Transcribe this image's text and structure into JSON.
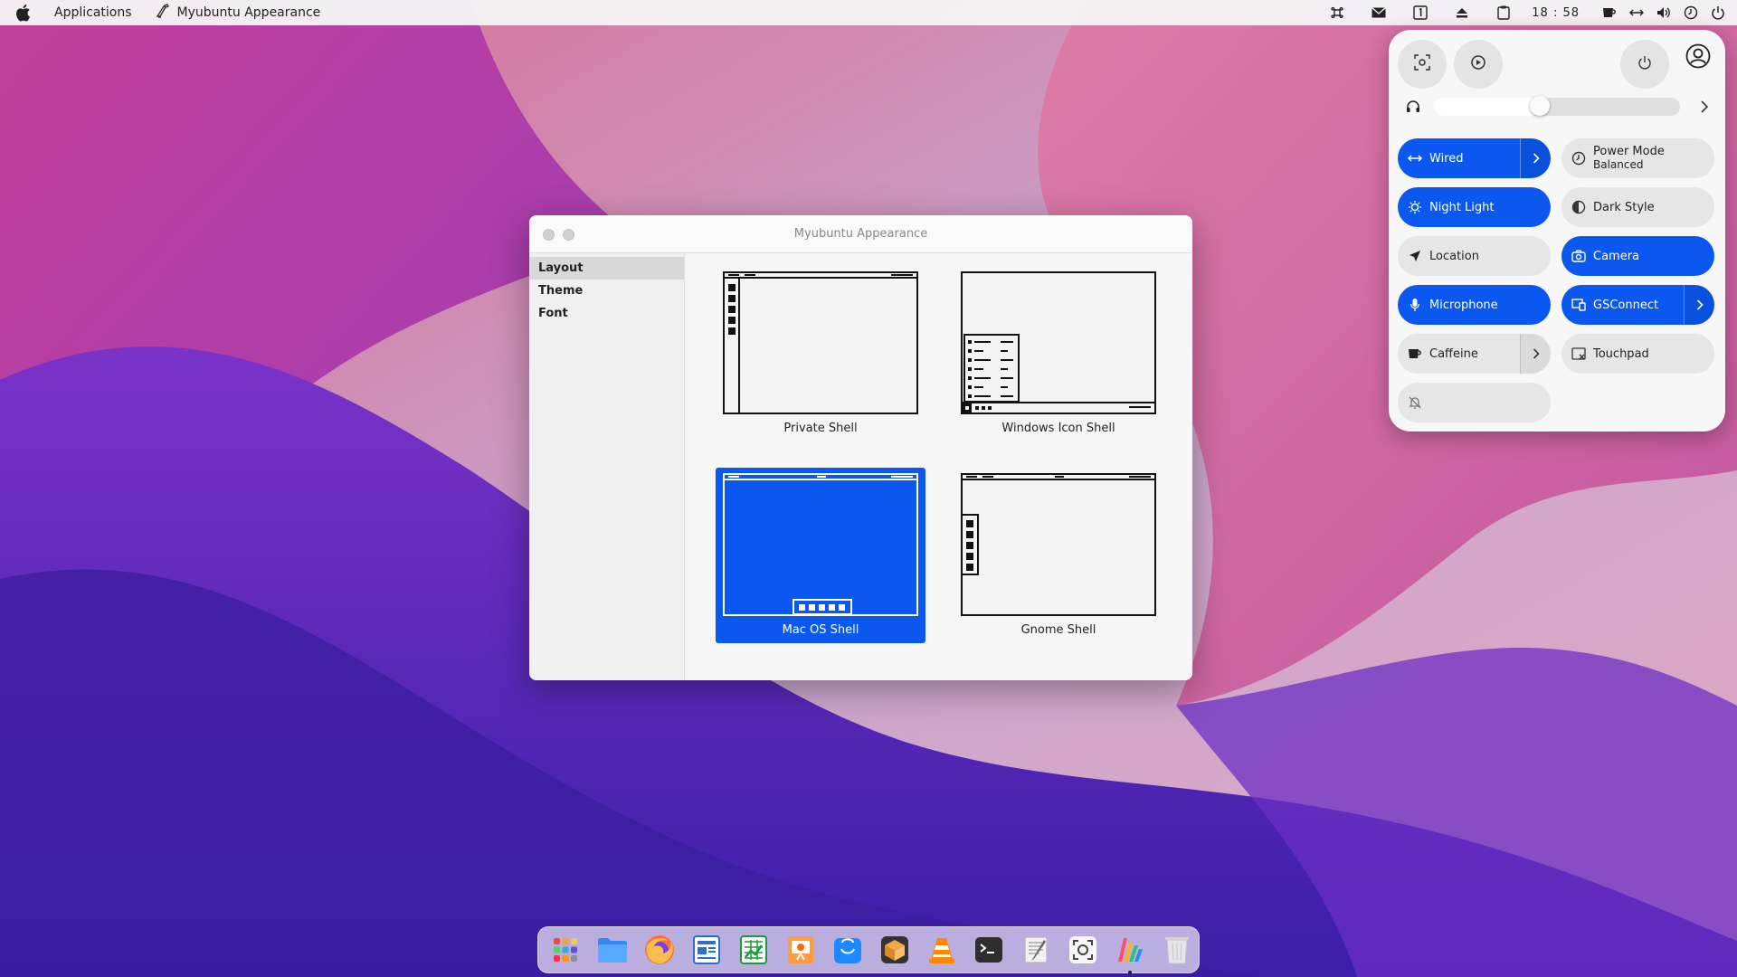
{
  "topbar": {
    "apple_icon": "apple-logo-icon",
    "menu_applications": "Applications",
    "active_app_title": "Myubuntu Appearance",
    "clock": "18 : 58",
    "tray_icons": [
      "command-icon",
      "mail-icon",
      "workspace-1-icon",
      "eject-icon",
      "clipboard-icon",
      "caffeine-icon",
      "network-wired-icon",
      "volume-icon",
      "power-mode-icon",
      "power-icon"
    ]
  },
  "window": {
    "title": "Myubuntu Appearance",
    "sidebar": {
      "items": [
        {
          "label": "Layout",
          "active": true
        },
        {
          "label": "Theme",
          "active": false
        },
        {
          "label": "Font",
          "active": false
        }
      ]
    },
    "layouts": [
      {
        "label": "Private Shell",
        "selected": false
      },
      {
        "label": "Windows Icon Shell",
        "selected": false
      },
      {
        "label": "Mac OS Shell",
        "selected": true
      },
      {
        "label": "Gnome Shell",
        "selected": false
      }
    ]
  },
  "quick_settings": {
    "volume_level": 0.43,
    "tiles": [
      {
        "label": "Wired",
        "sub": "",
        "on": true,
        "icon": "network-wired-icon",
        "has_arrow": true
      },
      {
        "label": "Power Mode",
        "sub": "Balanced",
        "on": false,
        "icon": "power-mode-icon",
        "has_arrow": false
      },
      {
        "label": "Night Light",
        "sub": "",
        "on": true,
        "icon": "night-light-icon",
        "has_arrow": false
      },
      {
        "label": "Dark Style",
        "sub": "",
        "on": false,
        "icon": "dark-style-icon",
        "has_arrow": false
      },
      {
        "label": "Location",
        "sub": "",
        "on": false,
        "icon": "location-icon",
        "has_arrow": false
      },
      {
        "label": "Camera",
        "sub": "",
        "on": true,
        "icon": "camera-icon",
        "has_arrow": false
      },
      {
        "label": "Microphone",
        "sub": "",
        "on": true,
        "icon": "microphone-icon",
        "has_arrow": false
      },
      {
        "label": "GSConnect",
        "sub": "",
        "on": true,
        "icon": "gsconnect-icon",
        "has_arrow": true
      },
      {
        "label": "Caffeine",
        "sub": "",
        "on": false,
        "icon": "caffeine-icon",
        "has_arrow": true
      },
      {
        "label": "Touchpad",
        "sub": "",
        "on": false,
        "icon": "touchpad-icon",
        "has_arrow": false
      },
      {
        "label": "",
        "sub": "",
        "on": false,
        "icon": "notifications-disabled-icon",
        "has_arrow": false
      }
    ]
  },
  "dock": {
    "apps": [
      "app-grid-icon",
      "files-icon",
      "firefox-icon",
      "writer-icon",
      "calc-icon",
      "impress-icon",
      "software-center-icon",
      "package-icon",
      "vlc-icon",
      "terminal-icon",
      "text-editor-icon",
      "screenshot-icon",
      "appearance-icon",
      "trash-icon"
    ],
    "running": "appearance-icon"
  }
}
